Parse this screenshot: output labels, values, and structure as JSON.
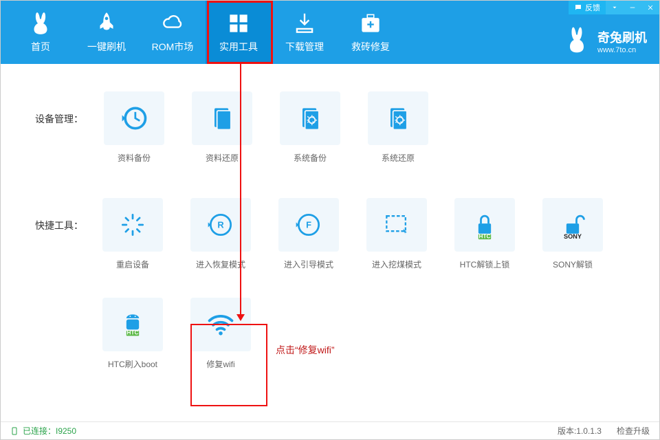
{
  "titlebar": {
    "feedback": "反馈"
  },
  "nav": {
    "items": [
      {
        "label": "首页"
      },
      {
        "label": "一键刷机"
      },
      {
        "label": "ROM市场"
      },
      {
        "label": "实用工具"
      },
      {
        "label": "下载管理"
      },
      {
        "label": "救砖修复"
      }
    ]
  },
  "brand": {
    "title": "奇兔刷机",
    "url": "www.7to.cn"
  },
  "sections": {
    "device": {
      "label": "设备管理：",
      "tiles": [
        {
          "label": "资料备份"
        },
        {
          "label": "资料还原"
        },
        {
          "label": "系统备份"
        },
        {
          "label": "系统还原"
        }
      ]
    },
    "quick": {
      "label": "快捷工具：",
      "tiles": [
        {
          "label": "重启设备"
        },
        {
          "label": "进入恢复模式"
        },
        {
          "label": "进入引导模式"
        },
        {
          "label": "进入挖煤模式"
        },
        {
          "label": "HTC解锁上锁"
        },
        {
          "label": "SONY解锁"
        },
        {
          "label": "HTC刷入boot"
        },
        {
          "label": "修复wifi"
        }
      ]
    }
  },
  "annotation": "点击“修复wifi”",
  "status": {
    "connected": "已连接：I9250",
    "version": "版本:1.0.1.3",
    "check": "检查升级"
  },
  "icons": {
    "htc_label": "HTC",
    "sony_label": "SONY"
  }
}
